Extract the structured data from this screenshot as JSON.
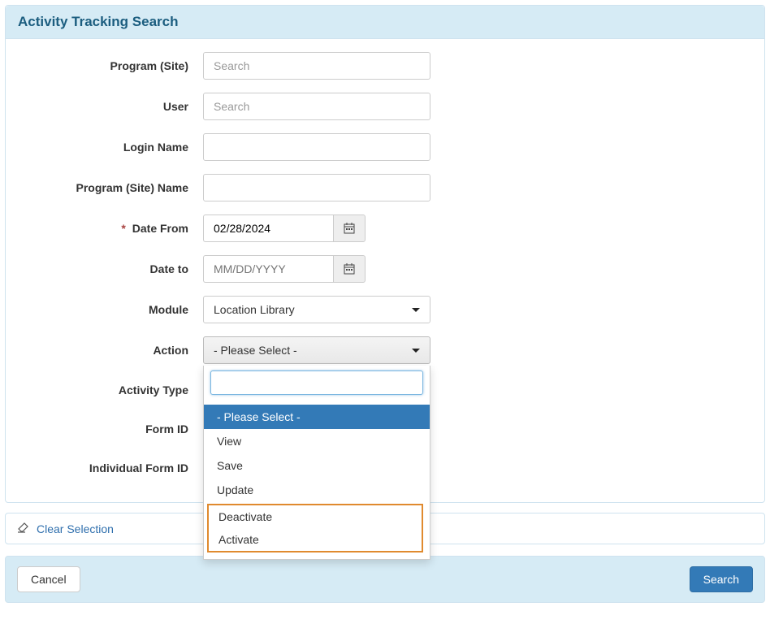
{
  "header": {
    "title": "Activity Tracking Search"
  },
  "labels": {
    "program_site": "Program (Site)",
    "user": "User",
    "login_name": "Login Name",
    "program_site_name": "Program (Site) Name",
    "date_from": "Date From",
    "date_to": "Date to",
    "module": "Module",
    "action": "Action",
    "activity_type": "Activity Type",
    "form_id": "Form ID",
    "individual_form_id": "Individual Form ID",
    "required_marker": "*"
  },
  "placeholders": {
    "search": "Search",
    "date": "MM/DD/YYYY"
  },
  "values": {
    "date_from": "02/28/2024",
    "module_selected": "Location Library",
    "action_selected": "- Please Select -"
  },
  "action_dropdown": {
    "search_value": "",
    "options": [
      {
        "label": "- Please Select -",
        "selected": true,
        "highlighted": false
      },
      {
        "label": "View",
        "selected": false,
        "highlighted": false
      },
      {
        "label": "Save",
        "selected": false,
        "highlighted": false
      },
      {
        "label": "Update",
        "selected": false,
        "highlighted": false
      },
      {
        "label": "Deactivate",
        "selected": false,
        "highlighted": true
      },
      {
        "label": "Activate",
        "selected": false,
        "highlighted": true
      }
    ]
  },
  "footer": {
    "clear_selection": "Clear Selection",
    "cancel": "Cancel",
    "search": "Search"
  }
}
